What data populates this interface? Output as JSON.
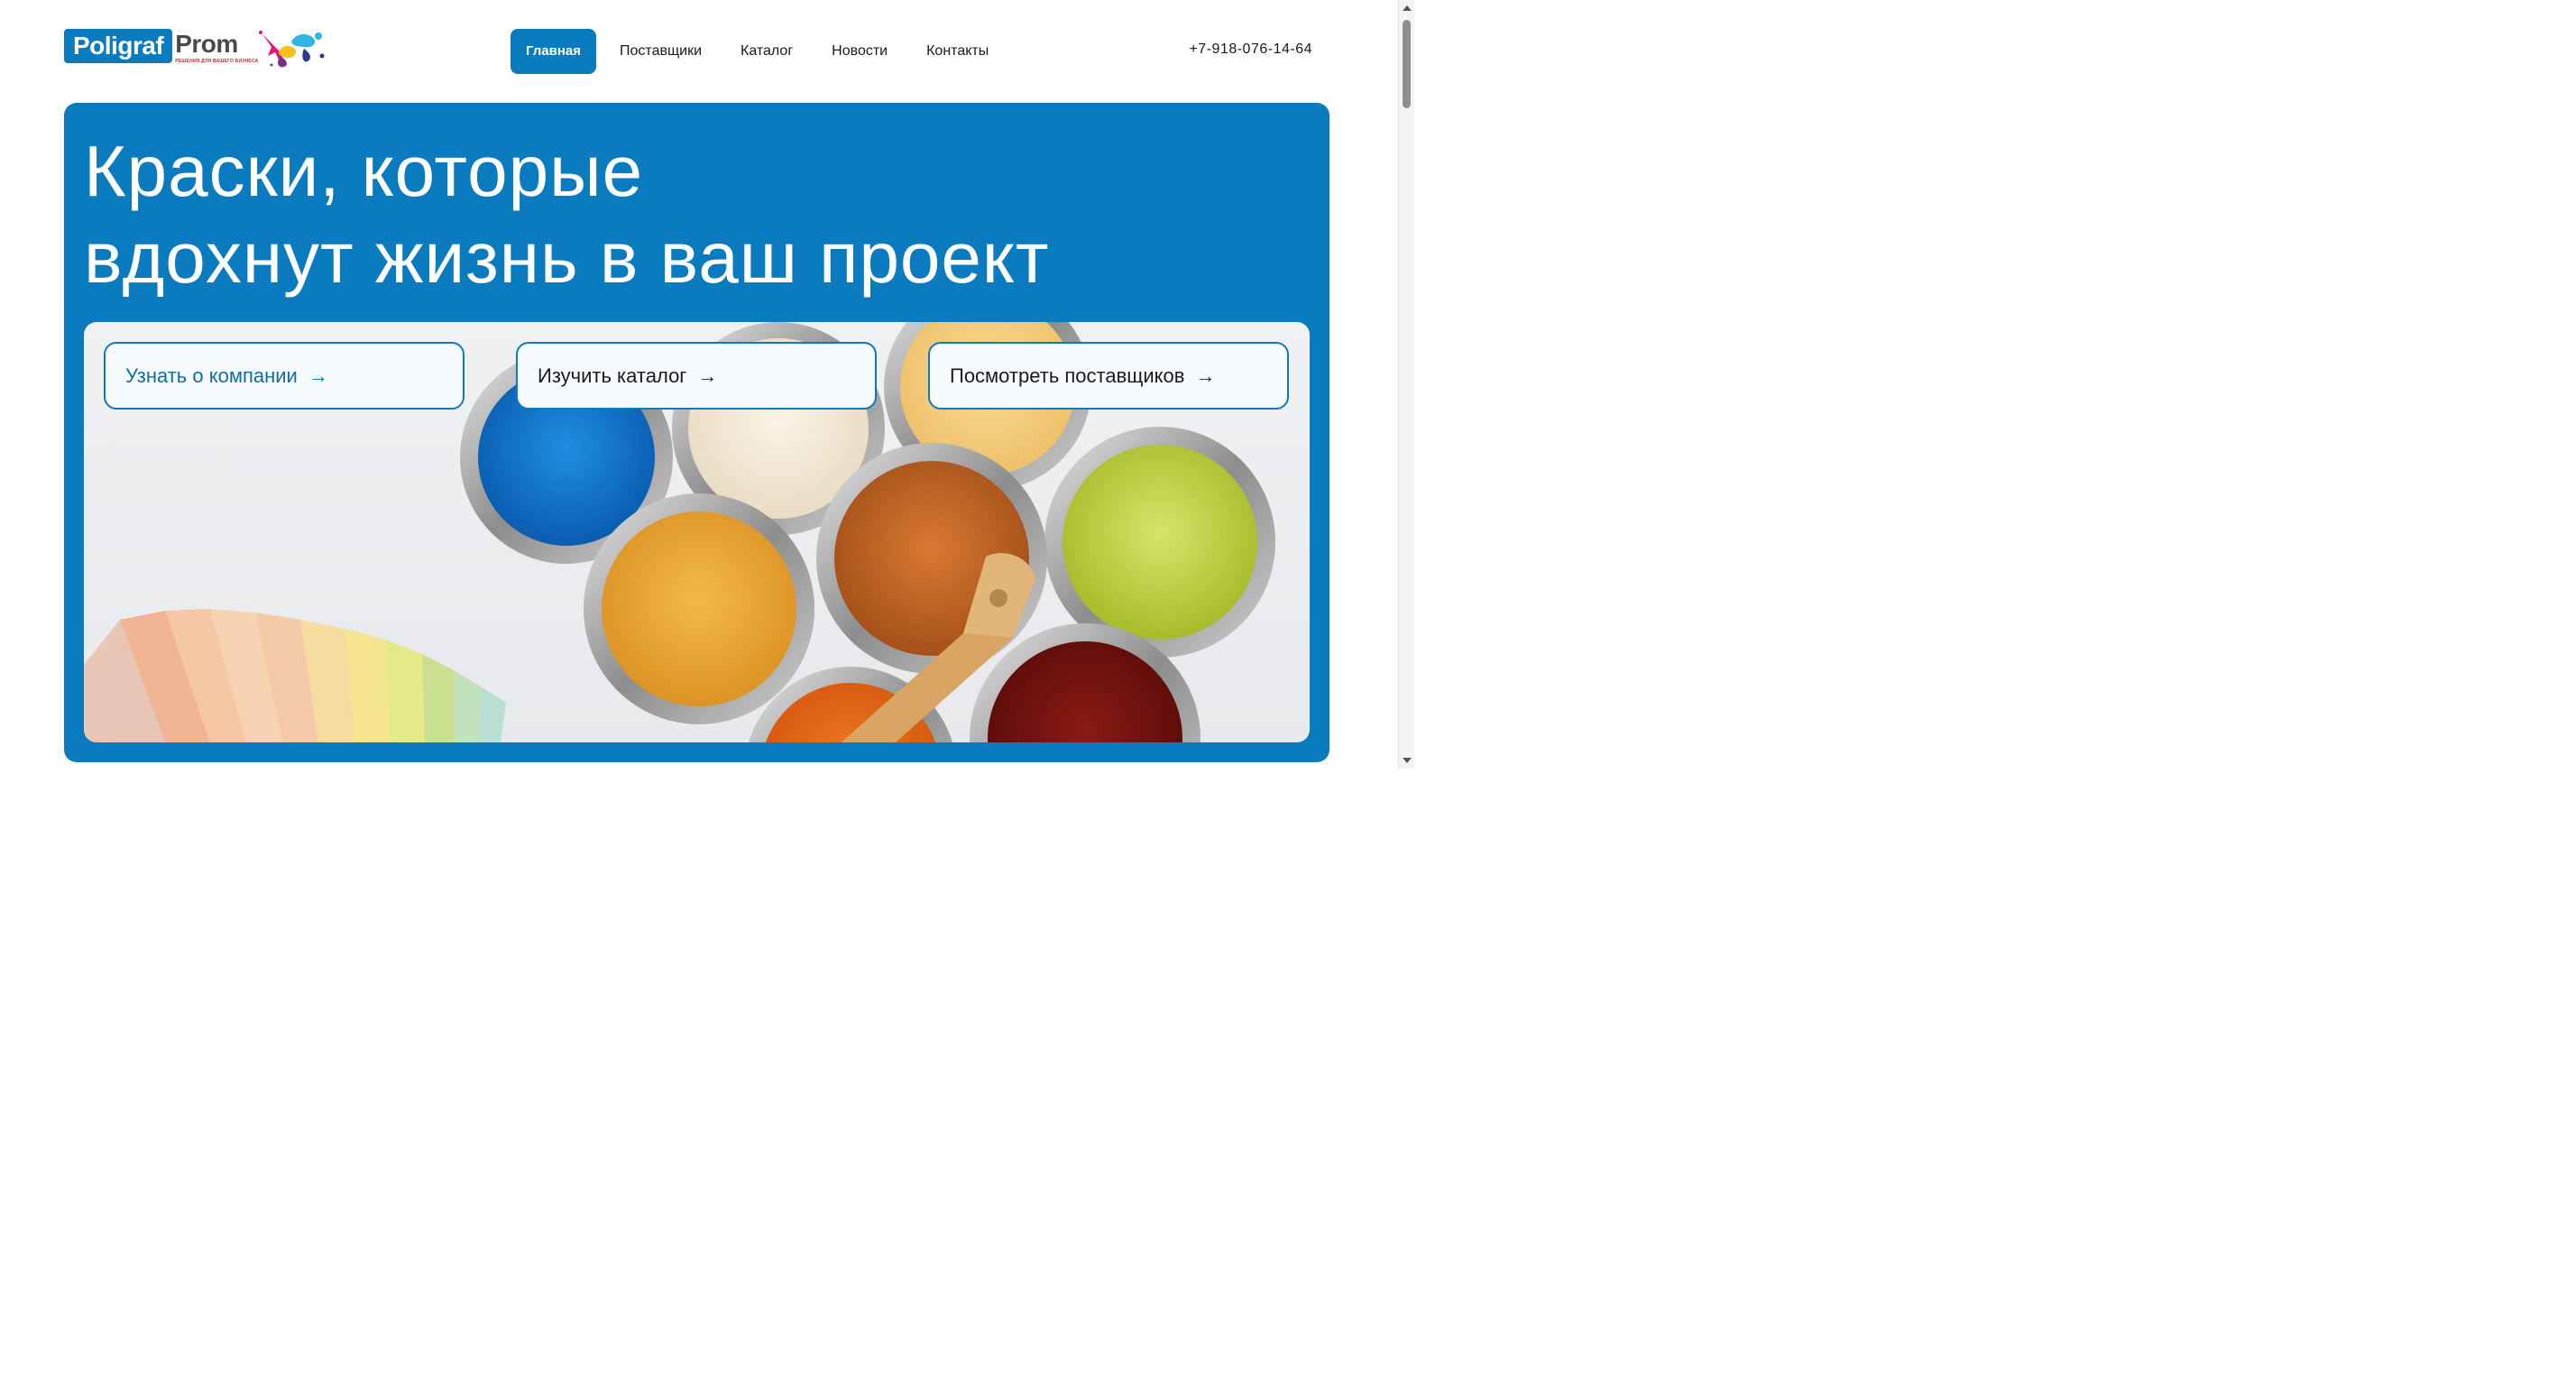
{
  "header": {
    "logo": {
      "part1": "Poligraf",
      "part2": "Prom",
      "tagline": "РЕШЕНИЯ ДЛЯ ВАШЕГО БИЗНЕСА"
    },
    "nav": [
      {
        "label": "Главная",
        "active": true
      },
      {
        "label": "Поставщики",
        "active": false
      },
      {
        "label": "Каталог",
        "active": false
      },
      {
        "label": "Новости",
        "active": false
      },
      {
        "label": "Контакты",
        "active": false
      }
    ],
    "phone": "+7-918-076-14-64"
  },
  "hero": {
    "title_line1": "Краски, которые",
    "title_line2": "вдохнут жизнь в ваш проект",
    "buttons": [
      {
        "label": "Узнать о компании",
        "arrow": "→"
      },
      {
        "label": "Изучить каталог",
        "arrow": "→"
      },
      {
        "label": "Посмотреть поставщиков",
        "arrow": "→"
      }
    ]
  },
  "colors": {
    "brand": "#0b7bbf",
    "text": "#1a1a1a",
    "logo_red": "#d7262b"
  }
}
